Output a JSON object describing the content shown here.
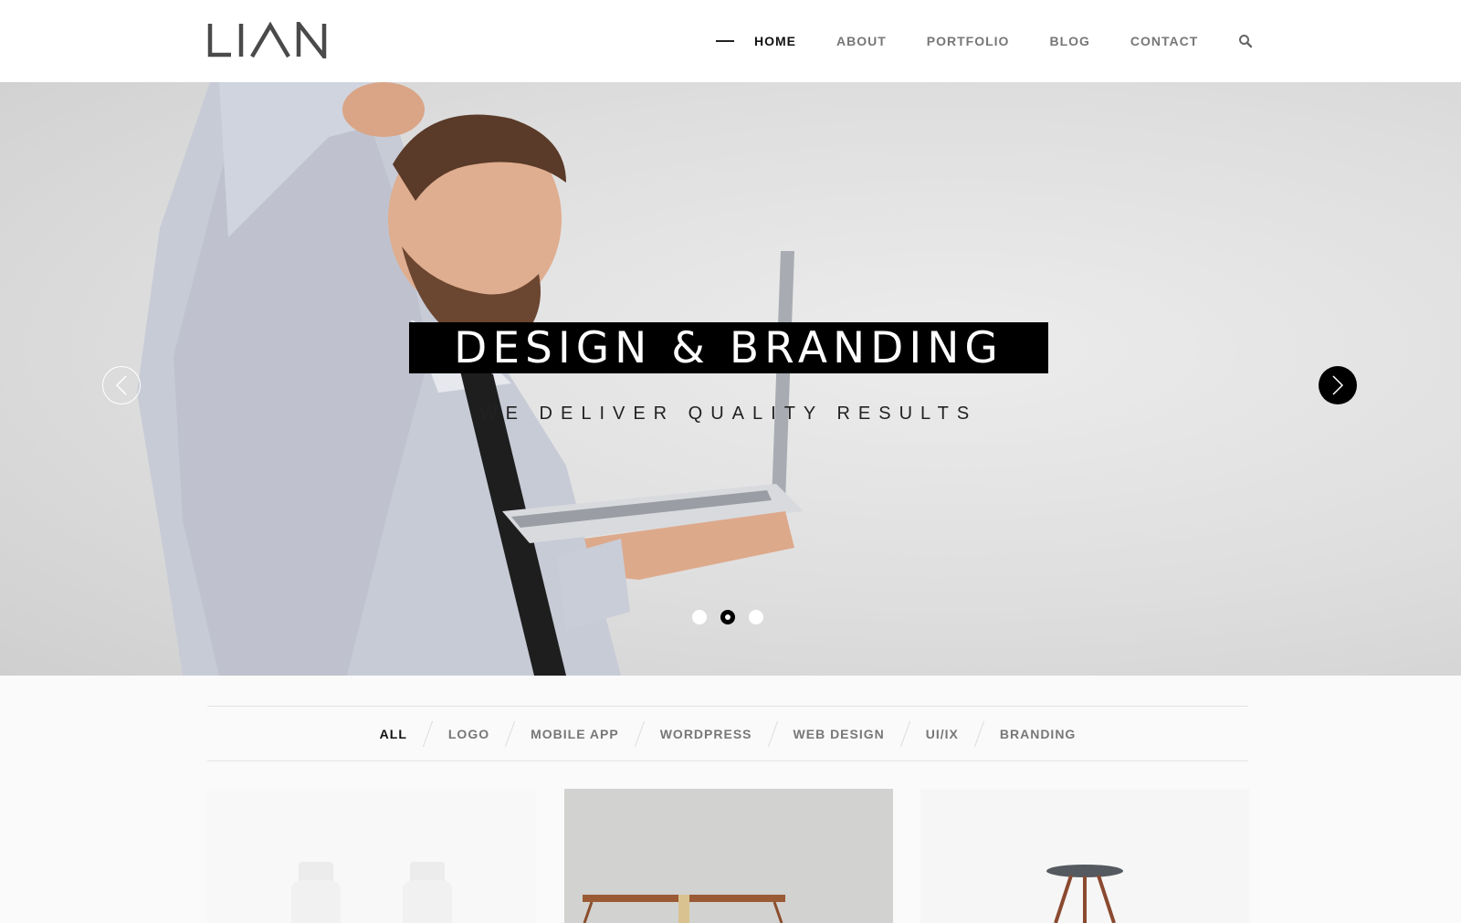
{
  "brand": {
    "logo_text": "LIAN"
  },
  "nav": {
    "items": [
      {
        "label": "HOME",
        "active": true
      },
      {
        "label": "ABOUT",
        "active": false
      },
      {
        "label": "PORTFOLIO",
        "active": false
      },
      {
        "label": "BLOG",
        "active": false
      },
      {
        "label": "CONTACT",
        "active": false
      }
    ],
    "search_icon": "search-icon"
  },
  "hero": {
    "title": "DESIGN & BRANDING",
    "subtitle": "WE DELIVER QUALITY RESULTS",
    "prev_icon": "chevron-left-icon",
    "next_icon": "chevron-right-icon",
    "slide_count": 3,
    "active_slide": 2
  },
  "filter": {
    "items": [
      {
        "label": "ALL",
        "active": true
      },
      {
        "label": "LOGO",
        "active": false
      },
      {
        "label": "MOBILE APP",
        "active": false
      },
      {
        "label": "WORDPRESS",
        "active": false
      },
      {
        "label": "WEB DESIGN",
        "active": false
      },
      {
        "label": "UI/IX",
        "active": false
      },
      {
        "label": "BRANDING",
        "active": false
      }
    ]
  },
  "colors": {
    "accent": "#000000",
    "nav_text": "#777777",
    "nav_active": "#111111"
  }
}
